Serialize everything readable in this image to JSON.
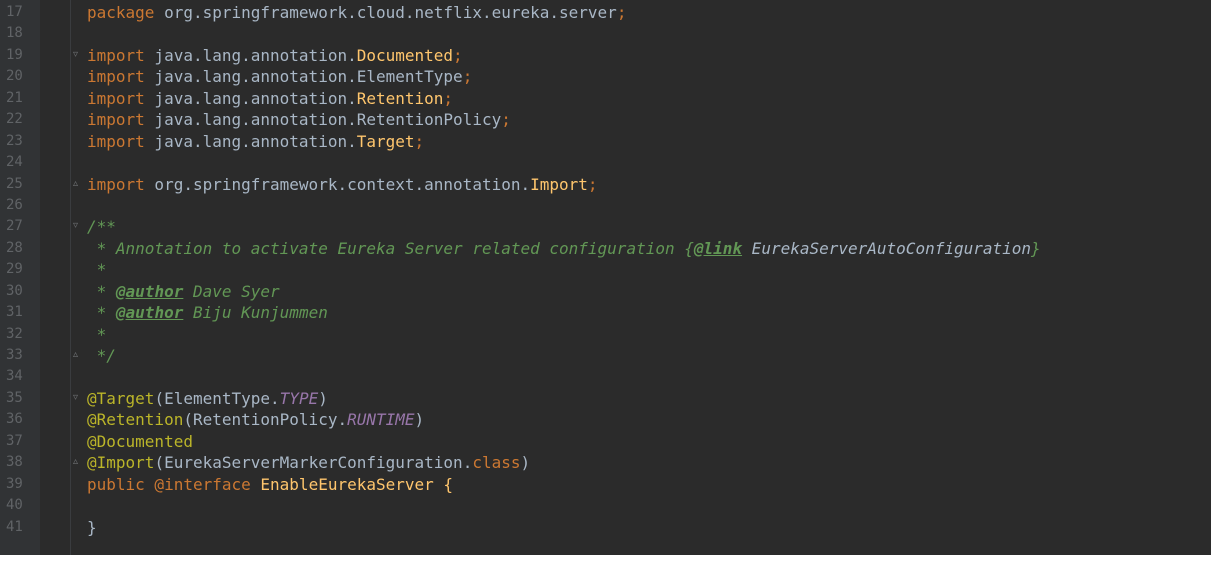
{
  "editor": {
    "colors": {
      "background": "#2b2b2b",
      "gutter": "#313335",
      "keyword": "#cc7832",
      "annotation": "#bbb529",
      "doc_comment": "#629755",
      "constant": "#9876aa"
    },
    "line_numbers": [
      "17",
      "18",
      "19",
      "20",
      "21",
      "22",
      "23",
      "24",
      "25",
      "26",
      "27",
      "28",
      "29",
      "30",
      "31",
      "32",
      "33",
      "34",
      "35",
      "36",
      "37",
      "38",
      "39",
      "40",
      "41"
    ],
    "code": {
      "l17": {
        "kw": "package",
        "rest": " org.springframework.cloud.netflix.eureka.server",
        "semi": ";"
      },
      "l19": {
        "kw": "import",
        "pkg": " java.lang.annotation.",
        "cls": "Documented",
        "semi": ";"
      },
      "l20": {
        "kw": "import",
        "pkg": " java.lang.annotation.ElementType",
        "semi": ";"
      },
      "l21": {
        "kw": "import",
        "pkg": " java.lang.annotation.",
        "cls": "Retention",
        "semi": ";"
      },
      "l22": {
        "kw": "import",
        "pkg": " java.lang.annotation.RetentionPolicy",
        "semi": ";"
      },
      "l23": {
        "kw": "import",
        "pkg": " java.lang.annotation.",
        "cls": "Target",
        "semi": ";"
      },
      "l25": {
        "kw": "import",
        "pkg": " org.springframework.context.annotation.",
        "cls": "Import",
        "semi": ";"
      },
      "l27": "/**",
      "l28": {
        "pre": " * Annotation to activate Eureka Server related configuration {",
        "tag": "@link",
        "ref": " EurekaServerAutoConfiguration",
        "post": "}"
      },
      "l29": " *",
      "l30": {
        "pre": " * ",
        "tag": "@author",
        "post": " Dave Syer"
      },
      "l31": {
        "pre": " * ",
        "tag": "@author",
        "post": " Biju Kunjummen"
      },
      "l32": " *",
      "l33": " */",
      "l35": {
        "ann": "@Target",
        "open": "(ElementType.",
        "const": "TYPE",
        "close": ")"
      },
      "l36": {
        "ann": "@Retention",
        "open": "(RetentionPolicy.",
        "const": "RUNTIME",
        "close": ")"
      },
      "l37": {
        "ann": "@Documented"
      },
      "l38": {
        "ann": "@Import",
        "open": "(EurekaServerMarkerConfiguration.",
        "kw": "class",
        "close": ")"
      },
      "l39": {
        "kw": "public",
        "ann": " @interface",
        "rest": " EnableEurekaServer {"
      },
      "l41": {
        "rest": "}"
      }
    }
  }
}
